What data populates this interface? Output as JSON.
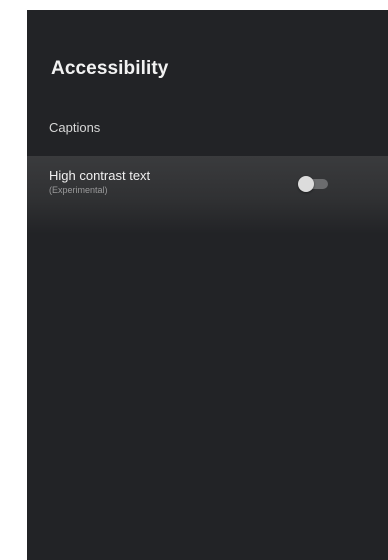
{
  "screen": {
    "title": "Accessibility"
  },
  "items": [
    {
      "label": "Captions"
    },
    {
      "label": "High contrast text",
      "sublabel": "(Experimental)",
      "toggle_state": "off"
    }
  ],
  "colors": {
    "panel_background": "#222326",
    "focused_row": "#3a3b3d",
    "toggle_thumb": "#dcdcdc",
    "toggle_track": "#6b6c6e"
  }
}
